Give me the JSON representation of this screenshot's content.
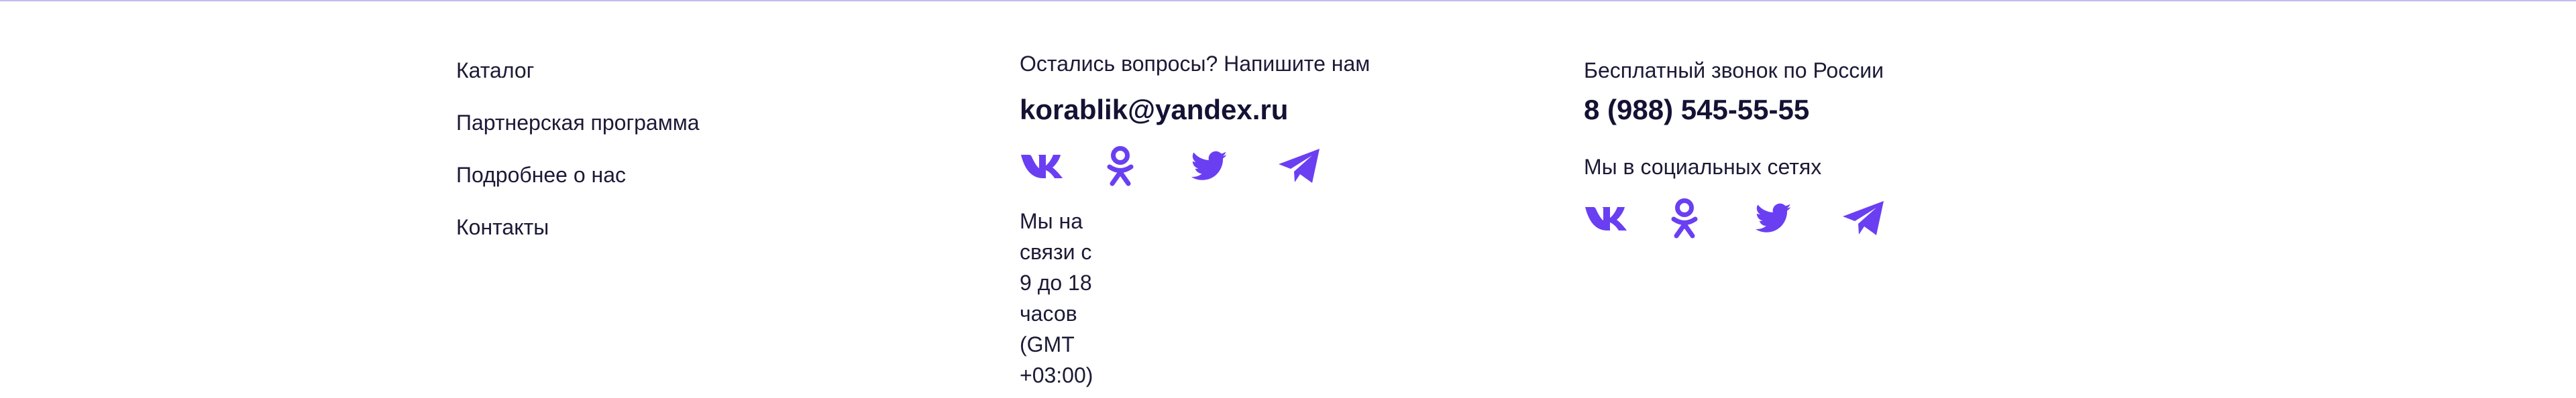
{
  "nav": {
    "items": [
      {
        "label": "Каталог"
      },
      {
        "label": "Партнерская программа"
      },
      {
        "label": "Подробнее о нас"
      },
      {
        "label": "Контакты"
      }
    ]
  },
  "contact": {
    "question": "Остались вопросы? Напишите нам",
    "email": "korablik@yandex.ru",
    "hours_line1": "Мы на связи с 9 до 18 часов",
    "hours_line2": "(GMT +03:00)",
    "socials": [
      "vk-icon",
      "odnoklassniki-icon",
      "twitter-icon",
      "telegram-icon"
    ]
  },
  "call": {
    "label": "Бесплатный звонок по России",
    "phone": "8 (988) 545-55-55",
    "social_label": "Мы в социальных сетях",
    "socials": [
      "vk-icon",
      "odnoklassniki-icon",
      "twitter-icon",
      "telegram-icon"
    ]
  },
  "colors": {
    "accent": "#6a3ff2",
    "text": "#1c1a36",
    "top_border": "#c3baf4"
  }
}
